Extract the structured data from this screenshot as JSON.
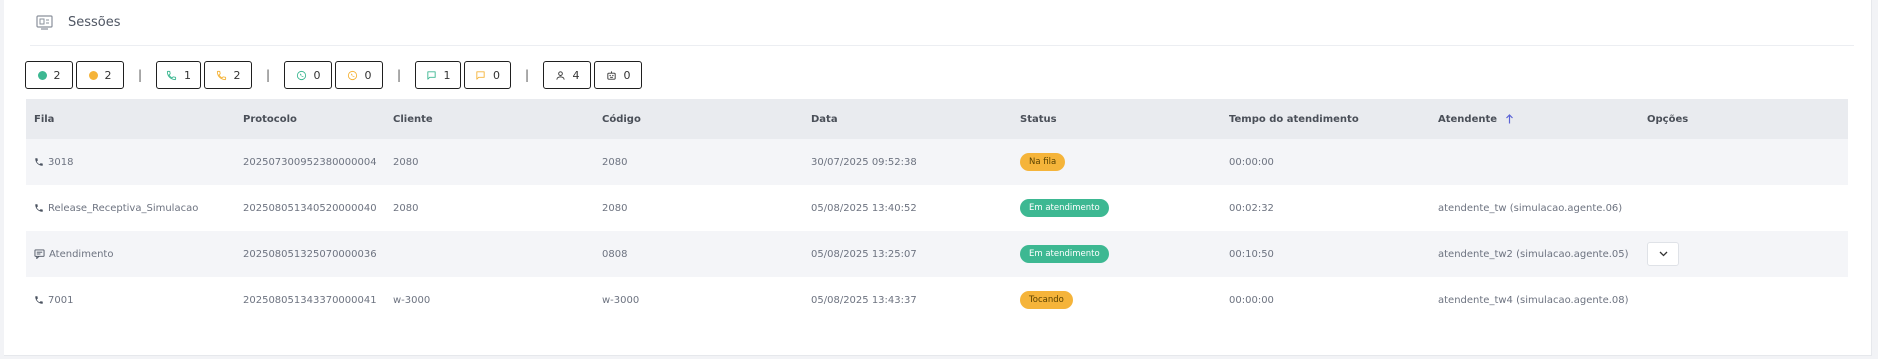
{
  "header": {
    "title": "Sessões",
    "icon": "monitor-sessions-icon"
  },
  "colors": {
    "green": "#3db892",
    "orange": "#f5b43a",
    "text": "#4b5360",
    "header_bg": "#e9ebef"
  },
  "counters": {
    "status_green": "2",
    "status_orange": "2",
    "phone_green": "1",
    "phone_orange": "2",
    "whatsapp_green": "0",
    "whatsapp_orange": "0",
    "chat_green": "1",
    "chat_orange": "0",
    "agents": "4",
    "robots": "0",
    "separator": "|"
  },
  "table": {
    "columns": {
      "fila": "Fila",
      "protocolo": "Protocolo",
      "cliente": "Cliente",
      "codigo": "Código",
      "data": "Data",
      "status": "Status",
      "tempo": "Tempo do atendimento",
      "atendente": "Atendente",
      "opcoes": "Opções"
    },
    "rows": [
      {
        "fila_icon": "phone-icon",
        "fila": "3018",
        "protocolo": "202507300952380000004",
        "cliente": "2080",
        "codigo": "2080",
        "data": "30/07/2025 09:52:38",
        "status": "Na fila",
        "tempo": "00:00:00",
        "atendente": ""
      },
      {
        "fila_icon": "phone-icon",
        "fila": "Release_Receptiva_Simulacao",
        "protocolo": "202508051340520000040",
        "cliente": "2080",
        "codigo": "2080",
        "data": "05/08/2025 13:40:52",
        "status": "Em atendimento",
        "tempo": "00:02:32",
        "atendente": "atendente_tw (simulacao.agente.06)"
      },
      {
        "fila_icon": "chat-icon",
        "fila": "Atendimento",
        "protocolo": "202508051325070000036",
        "cliente": "",
        "codigo": "0808",
        "data": "05/08/2025 13:25:07",
        "status": "Em atendimento",
        "tempo": "00:10:50",
        "atendente": "atendente_tw2 (simulacao.agente.05)"
      },
      {
        "fila_icon": "phone-icon",
        "fila": "7001",
        "protocolo": "202508051343370000041",
        "cliente": "w-3000",
        "codigo": "w-3000",
        "data": "05/08/2025 13:43:37",
        "status": "Tocando",
        "tempo": "00:00:00",
        "atendente": "atendente_tw4 (simulacao.agente.08)"
      }
    ]
  }
}
